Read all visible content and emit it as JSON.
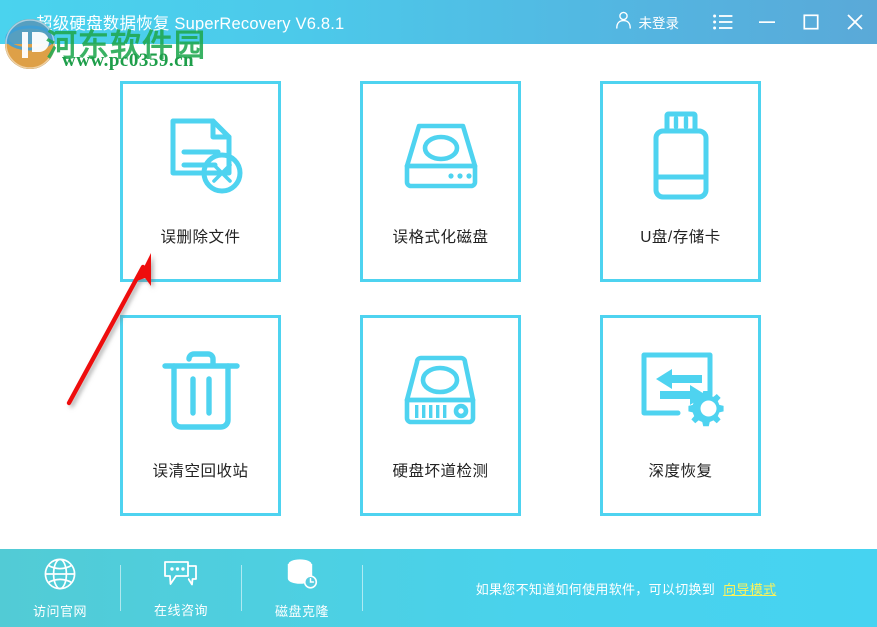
{
  "window": {
    "title": "超级硬盘数据恢复 SuperRecovery V6.8.1",
    "account_label": "未登录",
    "account_icon": "user-icon",
    "menu_icon": "list-menu-icon",
    "minimize_icon": "minimize-icon",
    "maximize_icon": "maximize-icon",
    "close_icon": "close-icon",
    "titlebar_gradient_start": "#4ad3ee",
    "titlebar_gradient_end": "#5aa9d8"
  },
  "theme": {
    "accent": "#4ed3f0",
    "card_border": "#4ed3f0",
    "label_color": "#222222",
    "link_color": "#fdf35a",
    "bottombar_start": "#52cbd5",
    "bottombar_end": "#46d3f1"
  },
  "main": {
    "cards": [
      {
        "label": "误删除文件",
        "icon": "deleted-file-icon"
      },
      {
        "label": "误格式化磁盘",
        "icon": "format-disk-icon"
      },
      {
        "label": "U盘/存储卡",
        "icon": "usb-drive-icon"
      },
      {
        "label": "误清空回收站",
        "icon": "recycle-bin-icon"
      },
      {
        "label": "硬盘坏道检测",
        "icon": "disk-health-icon"
      },
      {
        "label": "深度恢复",
        "icon": "deep-recovery-icon"
      }
    ]
  },
  "bottombar": {
    "items": [
      {
        "label": "访问官网",
        "icon": "globe-icon"
      },
      {
        "label": "在线咨询",
        "icon": "chat-icon"
      },
      {
        "label": "磁盘克隆",
        "icon": "disk-clone-icon"
      }
    ],
    "hint_text": "如果您不知道如何使用软件，可以切换到",
    "hint_link": "向导模式"
  },
  "watermark": {
    "site_name": "河东软件园",
    "url": "www.pc0359.cn"
  }
}
